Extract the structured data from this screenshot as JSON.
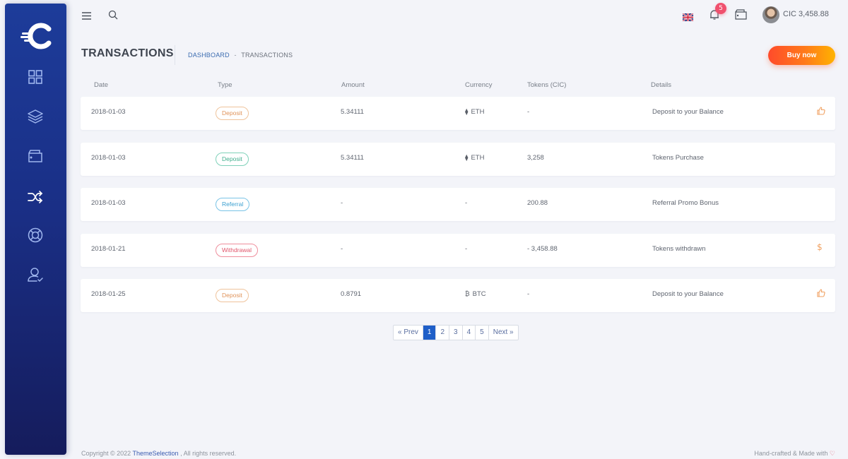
{
  "app": {
    "logo": "coin-logo"
  },
  "sidebar": {
    "items": [
      {
        "name": "dashboard",
        "icon": "grid-icon"
      },
      {
        "name": "layers",
        "icon": "layers-icon"
      },
      {
        "name": "wallet",
        "icon": "wallet-icon"
      },
      {
        "name": "transactions",
        "icon": "shuffle-icon",
        "active": true
      },
      {
        "name": "support",
        "icon": "lifebuoy-icon"
      },
      {
        "name": "profile",
        "icon": "user-check-icon"
      }
    ]
  },
  "topbar": {
    "language": "EN",
    "notifications_count": "5",
    "balance": "CIC 3,458.88"
  },
  "page": {
    "title": "TRANSACTIONS",
    "breadcrumb": {
      "link": "DASHBOARD",
      "separator": "-",
      "current": "TRANSACTIONS"
    },
    "buy_button": "Buy now"
  },
  "table": {
    "headers": [
      "Date",
      "Type",
      "Amount",
      "Currency",
      "Tokens (CIC)",
      "Details"
    ],
    "rows": [
      {
        "date": "2018-01-03",
        "type": "Deposit",
        "type_color": "orange",
        "amount": "5.34111",
        "currency_symbol": "⧫",
        "currency": "ETH",
        "tokens": "-",
        "details": "Deposit to your Balance",
        "action_icon": "thumbs-up-icon"
      },
      {
        "date": "2018-01-03",
        "type": "Deposit",
        "type_color": "green",
        "amount": "5.34111",
        "currency_symbol": "⧫",
        "currency": "ETH",
        "tokens": "3,258",
        "details": "Tokens Purchase",
        "action_icon": ""
      },
      {
        "date": "2018-01-03",
        "type": "Referral",
        "type_color": "blue",
        "amount": "-",
        "currency_symbol": "",
        "currency": "-",
        "tokens": "200.88",
        "details": "Referral Promo Bonus",
        "action_icon": ""
      },
      {
        "date": "2018-01-21",
        "type": "Withdrawal",
        "type_color": "red",
        "amount": "-",
        "currency_symbol": "",
        "currency": "-",
        "tokens": "- 3,458.88",
        "details": "Tokens withdrawn",
        "action_icon": "dollar-icon"
      },
      {
        "date": "2018-01-25",
        "type": "Deposit",
        "type_color": "orange",
        "amount": "0.8791",
        "currency_symbol": "₿",
        "currency": "BTC",
        "tokens": "-",
        "details": "Deposit to your Balance",
        "action_icon": "thumbs-up-icon"
      }
    ]
  },
  "pagination": {
    "prev": "« Prev",
    "pages": [
      "1",
      "2",
      "3",
      "4",
      "5"
    ],
    "active": "1",
    "next": "Next »"
  },
  "footer": {
    "copyright_prefix": "Copyright © 2022",
    "brand": "ThemeSelection",
    "copyright_suffix": ", All rights reserved.",
    "made_with": "Hand-crafted & Made with",
    "heart": "♡"
  },
  "colors": {
    "sidebar": "#1d3c9a",
    "accent": "#1f5fc8",
    "buy_start": "#ff4b2b",
    "buy_end": "#ffb300",
    "badge_orange": "#e0935a",
    "badge_green": "#3fae8c",
    "badge_blue": "#3a9fd0",
    "badge_red": "#e0566b"
  }
}
